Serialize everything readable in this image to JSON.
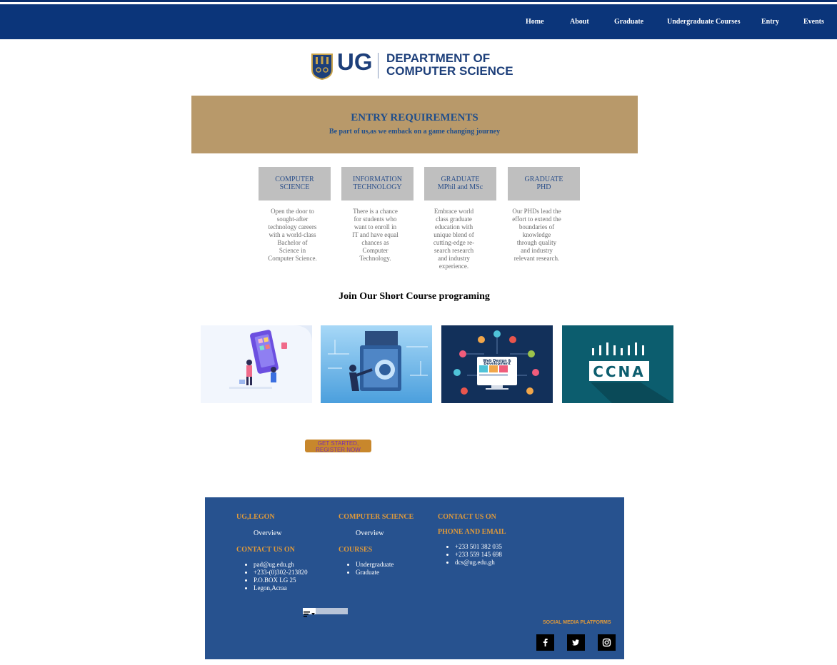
{
  "nav": {
    "items": [
      {
        "label": "Home"
      },
      {
        "label": "About"
      },
      {
        "label": "Graduate"
      },
      {
        "label": "Undergraduate Courses"
      },
      {
        "label": "Entry"
      },
      {
        "label": "Events"
      }
    ]
  },
  "logo": {
    "short": "UG",
    "line1": "DEPARTMENT OF",
    "line2": "COMPUTER SCIENCE"
  },
  "hero": {
    "title": "ENTRY REQUIREMENTS",
    "subtitle": "Be part of us,as we emback on a game changing journey"
  },
  "programs": [
    {
      "line1": "COMPUTER",
      "line2": "SCIENCE",
      "desc": [
        "Open the door to",
        "sought-after",
        "technology careers",
        "with a world-class",
        "Bachelor of",
        "Science in",
        "Computer Science."
      ]
    },
    {
      "line1": "INFORMATION",
      "line2": "TECHNOLOGY",
      "desc": [
        "There is a chance",
        "for students who",
        "want to enroll in",
        "IT and have equal",
        "chances as",
        "Computer",
        "Technology."
      ]
    },
    {
      "line1": "GRADUATE",
      "line2": "MPhil and MSc",
      "desc": [
        "Embrace world",
        "class graduate",
        "education with",
        "unique blend of",
        "cutting-edge re-",
        "search research",
        "and industry",
        "experience."
      ]
    },
    {
      "line1": "GRADUATE",
      "line2": "PHD",
      "desc": [
        "Our PHDs lead the",
        "effort to extend the",
        "boundaries of",
        "knowledge",
        "through quality",
        "and industry",
        "relevant research."
      ]
    }
  ],
  "short_course": {
    "heading": "Join Our Short Course programing",
    "thumbs": [
      {
        "name": "mobile-app-development-image"
      },
      {
        "name": "cyber-security-image"
      },
      {
        "name": "web-design-development-image",
        "caption1": "Web Design &",
        "caption2": "Development"
      },
      {
        "name": "ccna-image",
        "caption": "CCNA"
      }
    ]
  },
  "cta": {
    "line1": "GET STARTED,",
    "line2": "REGISTER NOW"
  },
  "footer": {
    "col1": {
      "heading": "UG,LEGON",
      "link": "Overview",
      "contact_heading": "CONTACT US ON",
      "contacts": [
        "pad@ug.edu.gh",
        "+233-(0)302-213820",
        "P.O.BOX LG 25",
        "Legon,Acraa"
      ]
    },
    "col2": {
      "heading": "COMPUTER SCIENCE",
      "link": "Overview",
      "courses_heading": "COURSES",
      "courses": [
        "Undergraduate",
        "Graduate"
      ]
    },
    "col3": {
      "heading1": "CONTACT US ON",
      "heading2": "PHONE AND EMAIL",
      "contacts": [
        "+233 501 382 035",
        "+233 559 145 698",
        "dcs@ug.edu.gh"
      ]
    },
    "social_label": "SOCIAL MEDIA PLATFORMS",
    "social": [
      {
        "icon": "facebook-icon",
        "glyph": "f"
      },
      {
        "icon": "twitter-icon",
        "glyph": "🐦"
      },
      {
        "icon": "instagram-icon",
        "glyph": "◎"
      }
    ]
  },
  "colors": {
    "nav": "#0b357a",
    "hero": "#b8996a",
    "footer": "#27528f",
    "accent": "#e09a3a",
    "cta": "#c8872c"
  }
}
